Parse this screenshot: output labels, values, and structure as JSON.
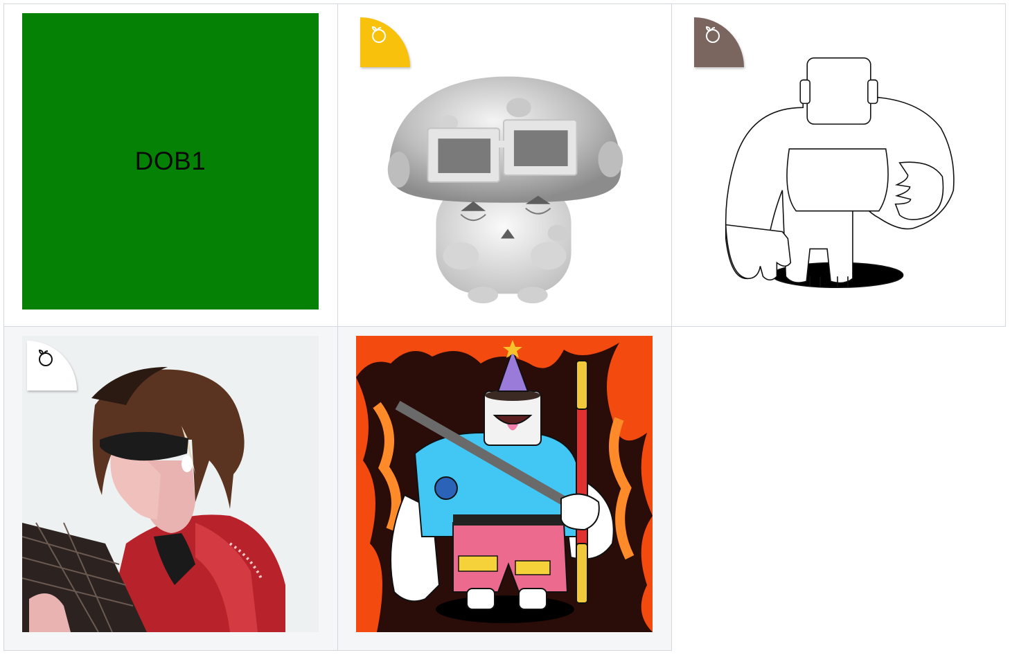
{
  "grid": {
    "items": [
      {
        "id": "tile-1",
        "text": "DOB1",
        "background": "#058105"
      },
      {
        "id": "tile-2",
        "badge_color": "#f8c20c",
        "badge_icon": "fruit-icon",
        "image": "gray-mushroom-with-sunglasses"
      },
      {
        "id": "tile-3",
        "badge_color": "#7b665f",
        "badge_icon": "fruit-icon",
        "image": "line-art-figure"
      },
      {
        "id": "tile-4",
        "badge_color": "#ffffff",
        "badge_icon": "fruit-icon",
        "image": "man-with-sunglasses-and-fan"
      },
      {
        "id": "tile-5",
        "image": "cartoon-figure-with-staff-and-flames"
      }
    ]
  },
  "colors": {
    "border": "#d3d8de",
    "alt_background": "#f4f6f8",
    "green_tile": "#058105",
    "yellow_badge": "#f8c20c",
    "brown_badge": "#7b665f",
    "white_badge": "#ffffff"
  }
}
